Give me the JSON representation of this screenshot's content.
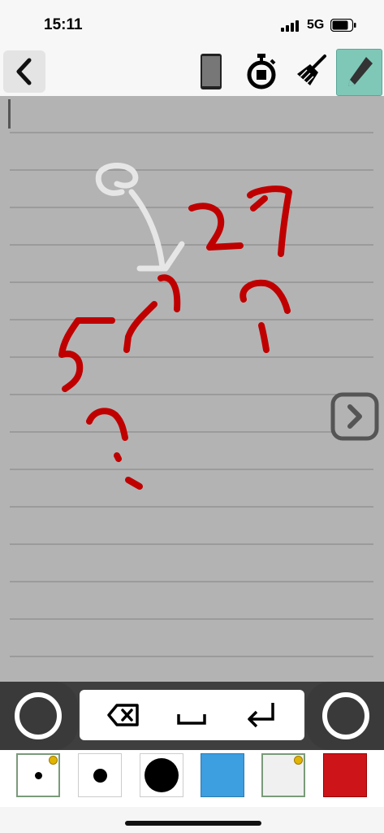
{
  "status": {
    "time": "15:11",
    "network": "5G"
  },
  "toolbar": {
    "back_icon": "chevron-left-icon",
    "phone_icon": "phone-icon",
    "timer_icon": "stopwatch-icon",
    "clear_icon": "broom-icon",
    "pen_icon": "pencil-icon",
    "pen_active_color": "#7fc8b8"
  },
  "canvas": {
    "background": "#b3b3b3",
    "ink_red": "#c00000",
    "ink_white": "#e8e8e8",
    "next_icon": "chevron-right-icon"
  },
  "keys": {
    "backspace_icon": "backspace-icon",
    "space_icon": "space-bar-icon",
    "enter_icon": "enter-return-icon"
  },
  "palette": {
    "items": [
      {
        "name": "small-pen-size",
        "color": "#000000",
        "selected": true
      },
      {
        "name": "medium-pen-size",
        "color": "#000000",
        "selected": false
      },
      {
        "name": "large-pen-size",
        "color": "#000000",
        "selected": false
      },
      {
        "name": "blue-color",
        "color": "#3d9ee0",
        "selected": false
      },
      {
        "name": "white-color",
        "color": "#f0f0f0",
        "selected": false
      },
      {
        "name": "red-color",
        "color": "#cc1419",
        "selected": false
      }
    ]
  }
}
